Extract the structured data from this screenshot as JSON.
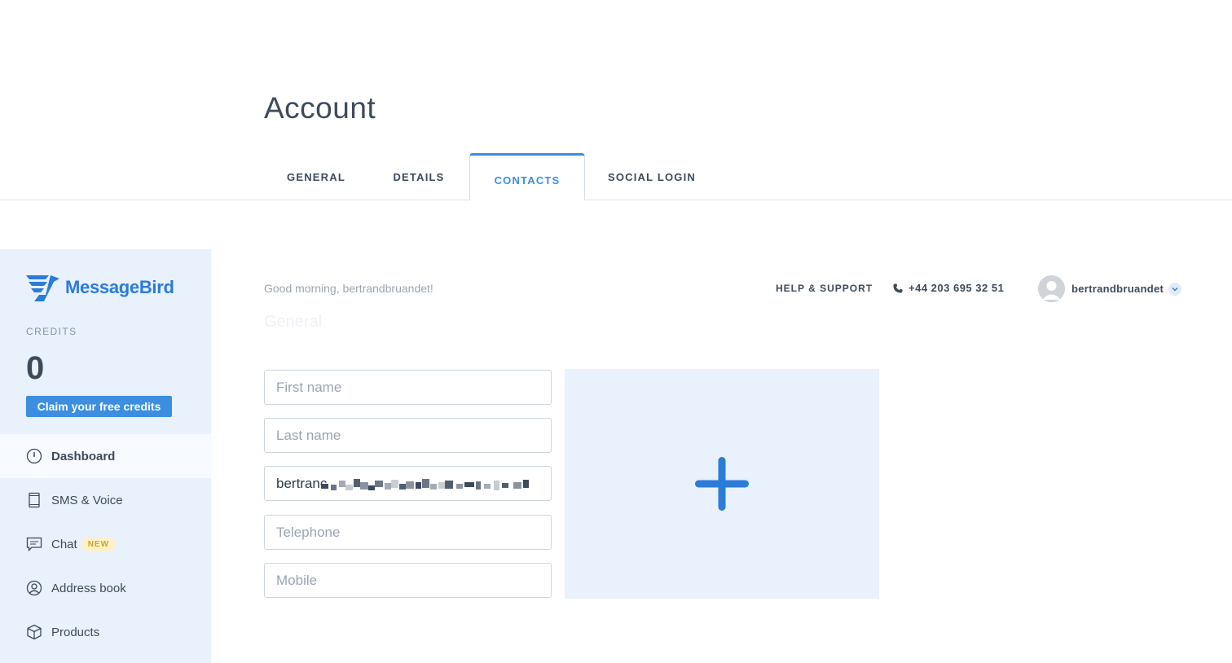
{
  "header": {
    "title": "Account",
    "tabs": [
      {
        "label": "GENERAL",
        "active": false
      },
      {
        "label": "DETAILS",
        "active": false
      },
      {
        "label": "CONTACTS",
        "active": true
      },
      {
        "label": "SOCIAL LOGIN",
        "active": false
      }
    ]
  },
  "sidebar": {
    "brand": "MessageBird",
    "credits_label": "CREDITS",
    "credits_value": "0",
    "claim_label": "Claim your free credits",
    "items": [
      {
        "label": "Dashboard",
        "icon": "dashboard-icon",
        "active": true
      },
      {
        "label": "SMS & Voice",
        "icon": "phone-device-icon",
        "active": false
      },
      {
        "label": "Chat",
        "icon": "chat-icon",
        "badge": "NEW",
        "active": false
      },
      {
        "label": "Address book",
        "icon": "user-circle-icon",
        "active": false
      },
      {
        "label": "Products",
        "icon": "box-icon",
        "active": false
      }
    ]
  },
  "topbar": {
    "greeting": "Good morning, bertrandbruandet!",
    "help": "HELP & SUPPORT",
    "phone": "+44 203 695 32 51",
    "username": "bertrandbruandet"
  },
  "section_title": "General",
  "form": {
    "first_name": {
      "placeholder": "First name",
      "value": ""
    },
    "last_name": {
      "placeholder": "Last name",
      "value": ""
    },
    "email": {
      "placeholder": "",
      "value": "bertranc"
    },
    "telephone": {
      "placeholder": "Telephone",
      "value": ""
    },
    "mobile": {
      "placeholder": "Mobile",
      "value": ""
    }
  },
  "colors": {
    "accent": "#3b8ee0",
    "brand": "#2b7bd9",
    "sidebar_bg": "#e8f1fc",
    "badge_bg": "#fdf1c8",
    "badge_text": "#c9a42a"
  }
}
